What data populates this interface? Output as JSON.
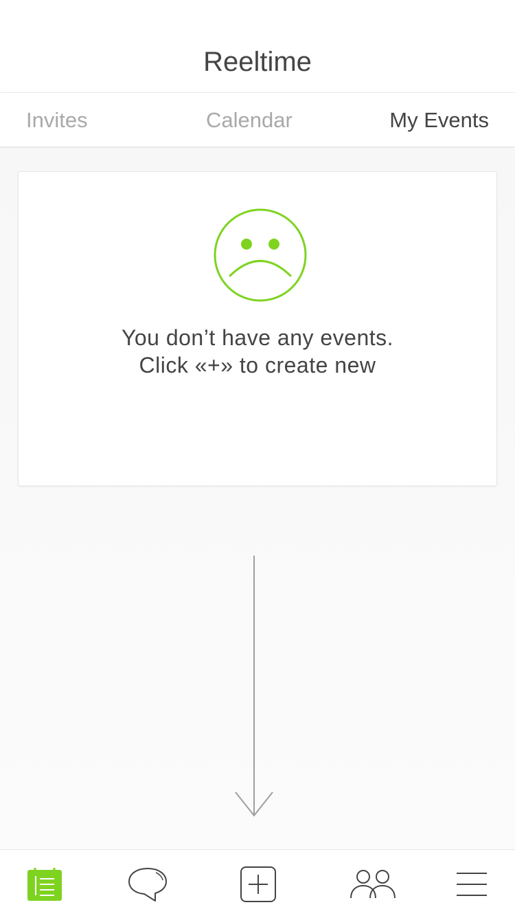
{
  "header": {
    "title": "Reeltime"
  },
  "tabs": [
    {
      "label": "Invites",
      "active": false
    },
    {
      "label": "Calendar",
      "active": false
    },
    {
      "label": "My Events",
      "active": true
    }
  ],
  "empty_state": {
    "icon": "sad-face-icon",
    "line1": "You don’t have any events.",
    "line2": "Click «+» to create new"
  },
  "hint": {
    "icon": "arrow-down-icon"
  },
  "tabbar": {
    "items": [
      {
        "icon": "events-list-icon",
        "active": true
      },
      {
        "icon": "chat-bubble-icon",
        "active": false
      },
      {
        "icon": "add-square-icon",
        "active": false
      },
      {
        "icon": "friends-icon",
        "active": false
      },
      {
        "icon": "menu-icon",
        "active": false
      }
    ]
  },
  "colors": {
    "accent": "#7ed321",
    "text": "#444444",
    "inactive_tab": "#a9a9a9",
    "background": "#fafafa"
  }
}
